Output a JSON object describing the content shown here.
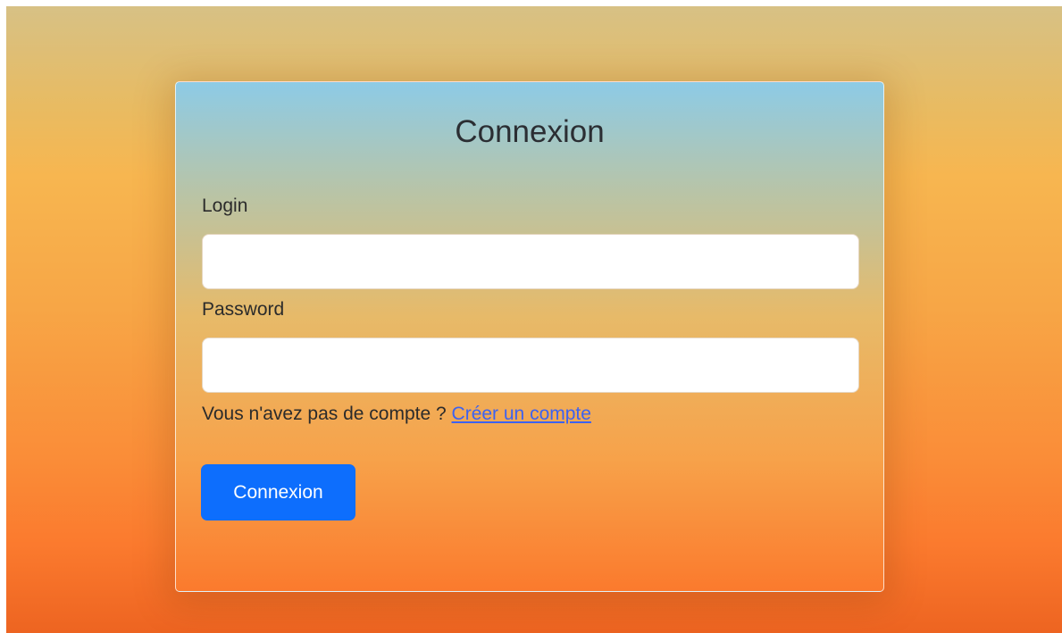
{
  "login_form": {
    "title": "Connexion",
    "login_label": "Login",
    "login_value": "",
    "password_label": "Password",
    "password_value": "",
    "signup_prompt": "Vous n'avez pas de compte ?",
    "signup_link": "Créer un compte",
    "submit_label": "Connexion"
  },
  "colors": {
    "primary_button": "#0d6efd",
    "link": "#3d62f0",
    "card_top": "#8dcbe6",
    "background_bottom": "#ed6421"
  }
}
